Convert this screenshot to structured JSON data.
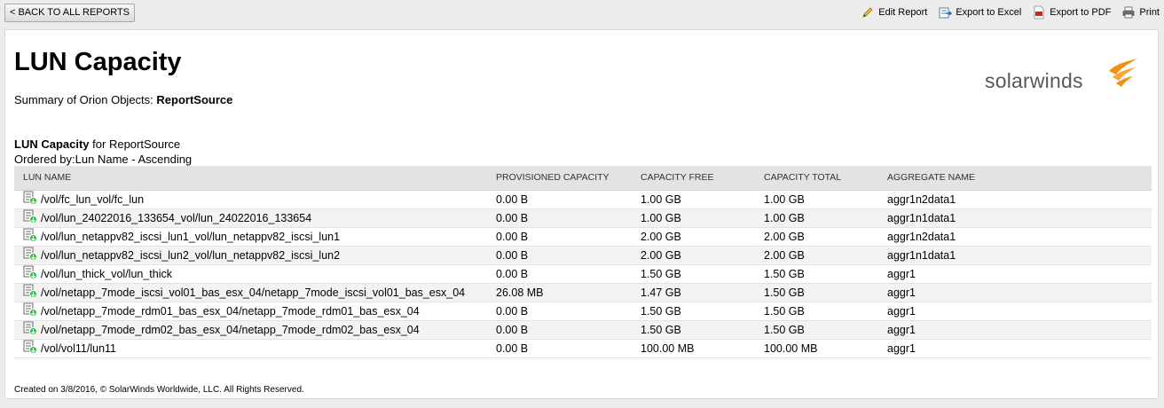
{
  "toolbar": {
    "back_label": "< BACK TO ALL REPORTS",
    "edit_label": "Edit Report",
    "excel_label": "Export to Excel",
    "pdf_label": "Export to PDF",
    "print_label": "Print"
  },
  "report": {
    "title": "LUN Capacity",
    "summary_prefix": "Summary of Orion Objects:",
    "summary_source": "ReportSource",
    "logo_text": "solarwinds"
  },
  "section": {
    "title_bold": "LUN Capacity",
    "title_for": "for",
    "title_source": "ReportSource",
    "ordered_by": "Ordered by:Lun Name - Ascending"
  },
  "table": {
    "columns": [
      "LUN NAME",
      "PROVISIONED CAPACITY",
      "CAPACITY FREE",
      "CAPACITY TOTAL",
      "AGGREGATE NAME"
    ],
    "rows": [
      [
        "/vol/fc_lun_vol/fc_lun",
        "0.00 B",
        "1.00 GB",
        "1.00 GB",
        "aggr1n2data1"
      ],
      [
        "/vol/lun_24022016_133654_vol/lun_24022016_133654",
        "0.00 B",
        "1.00 GB",
        "1.00 GB",
        "aggr1n1data1"
      ],
      [
        "/vol/lun_netappv82_iscsi_lun1_vol/lun_netappv82_iscsi_lun1",
        "0.00 B",
        "2.00 GB",
        "2.00 GB",
        "aggr1n2data1"
      ],
      [
        "/vol/lun_netappv82_iscsi_lun2_vol/lun_netappv82_iscsi_lun2",
        "0.00 B",
        "2.00 GB",
        "2.00 GB",
        "aggr1n1data1"
      ],
      [
        "/vol/lun_thick_vol/lun_thick",
        "0.00 B",
        "1.50 GB",
        "1.50 GB",
        "aggr1"
      ],
      [
        "/vol/netapp_7mode_iscsi_vol01_bas_esx_04/netapp_7mode_iscsi_vol01_bas_esx_04",
        "26.08 MB",
        "1.47 GB",
        "1.50 GB",
        "aggr1"
      ],
      [
        "/vol/netapp_7mode_rdm01_bas_esx_04/netapp_7mode_rdm01_bas_esx_04",
        "0.00 B",
        "1.50 GB",
        "1.50 GB",
        "aggr1"
      ],
      [
        "/vol/netapp_7mode_rdm02_bas_esx_04/netapp_7mode_rdm02_bas_esx_04",
        "0.00 B",
        "1.50 GB",
        "1.50 GB",
        "aggr1"
      ],
      [
        "/vol/vol11/lun11",
        "0.00 B",
        "100.00 MB",
        "100.00 MB",
        "aggr1"
      ]
    ]
  },
  "footer": {
    "text": "Created on 3/8/2016,   © SolarWinds Worldwide, LLC. All Rights Reserved."
  },
  "colors": {
    "header_bg": "#e5e2e2",
    "row_alt_bg": "#f5f2f2",
    "logo_orange": "#f29111",
    "status_up": "#36b24a"
  },
  "icons": {
    "edit": "pencil-icon",
    "excel": "export-excel-icon",
    "pdf": "pdf-icon",
    "print": "printer-icon",
    "lun": "lun-status-up-icon"
  }
}
